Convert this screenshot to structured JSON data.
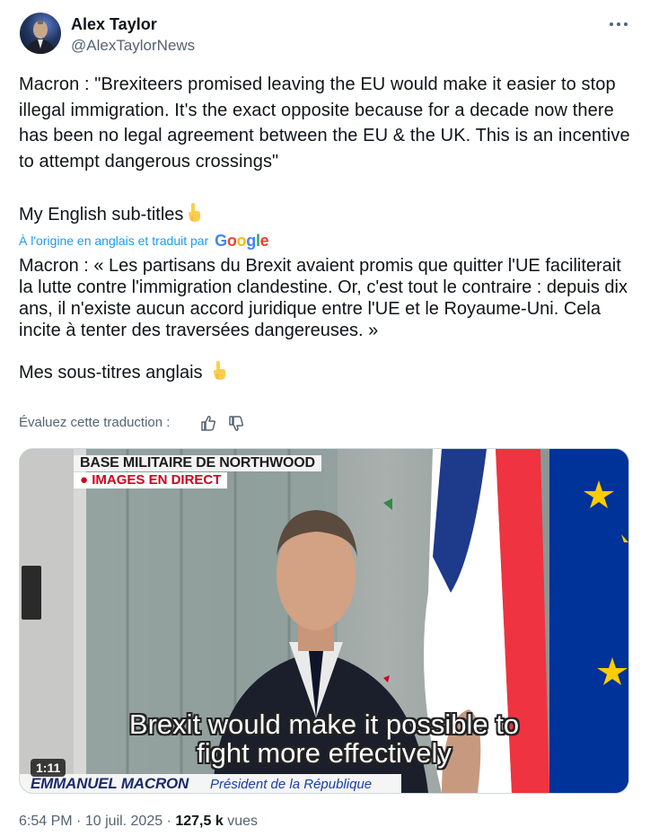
{
  "author": {
    "name": "Alex Taylor",
    "handle": "@AlexTaylorNews"
  },
  "tweet": {
    "text": "Macron : \"Brexiteers promised leaving the EU would make it easier to stop illegal immigration. It's the exact opposite because for a decade now there has been no legal agreement between the EU & the UK. This is an incentive to attempt dangerous crossings\"",
    "subtitle_line": "My English sub-titles",
    "emoji": "backhand-index-pointing-down-icon"
  },
  "translation": {
    "notice": "À l'origine en anglais et traduit par",
    "brand": "Google",
    "text": "Macron : « Les partisans du Brexit avaient promis que quitter l'UE faciliterait la lutte contre l'immigration clandestine. Or, c'est tout le contraire : depuis dix ans, il n'existe aucun accord juridique entre l'UE et le Royaume-Uni. Cela incite à tenter des traversées dangereuses. »",
    "subtitle_line": "Mes sous-titres anglais",
    "rate_label": "Évaluez cette traduction :"
  },
  "video": {
    "banner_location": "BASE MILITAIRE DE NORTHWOOD",
    "banner_live": "● IMAGES EN DIRECT",
    "subtitle_line1": "Brexit would make it possible to",
    "subtitle_line2": "fight more effectively",
    "duration": "1:11",
    "speaker_name": "EMMANUEL MACRON",
    "speaker_role": "Président de la République"
  },
  "meta": {
    "time": "6:54 PM",
    "separator": "·",
    "date": "10 juil. 2025",
    "views_count": "127,5 k",
    "views_label": "vues"
  },
  "colors": {
    "link": "#1d9bf0",
    "secondary_text": "#536471",
    "primary_text": "#0f1419",
    "eu_blue": "#003399",
    "eu_star": "#ffcc00"
  }
}
